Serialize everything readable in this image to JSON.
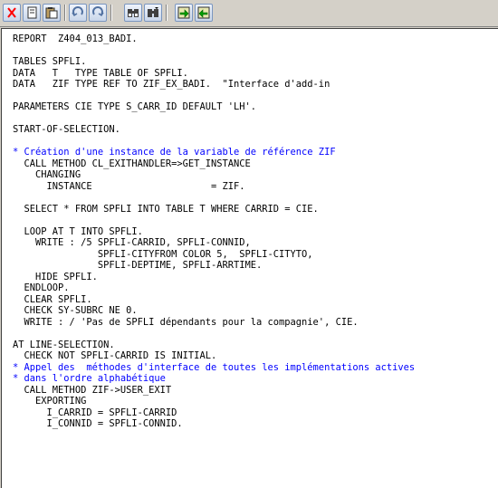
{
  "toolbar": {
    "buttons": [
      {
        "name": "cut-icon",
        "color": "#ff0000"
      },
      {
        "name": "copy-icon",
        "color": "#ffffff"
      },
      {
        "name": "paste-icon",
        "color": "#c0a060"
      },
      {
        "name": "undo-icon",
        "color": "#5070a0"
      },
      {
        "name": "redo-icon",
        "color": "#5070a0"
      },
      {
        "name": "find-icon",
        "color": "#000000"
      },
      {
        "name": "find-next-icon",
        "color": "#000000"
      },
      {
        "name": "download-icon",
        "color": "#00a000"
      },
      {
        "name": "upload-icon",
        "color": "#00a000"
      }
    ]
  },
  "code_lines": [
    {
      "text": "REPORT  Z404_013_BADI.",
      "comment": false
    },
    {
      "text": "",
      "comment": false
    },
    {
      "text": "TABLES SPFLI.",
      "comment": false
    },
    {
      "text": "DATA   T   TYPE TABLE OF SPFLI.",
      "comment": false
    },
    {
      "text": "DATA   ZIF TYPE REF TO ZIF_EX_BADI.  \"Interface d'add-in",
      "comment": false
    },
    {
      "text": "",
      "comment": false
    },
    {
      "text": "PARAMETERS CIE TYPE S_CARR_ID DEFAULT 'LH'.",
      "comment": false
    },
    {
      "text": "",
      "comment": false
    },
    {
      "text": "START-OF-SELECTION.",
      "comment": false
    },
    {
      "text": "",
      "comment": false
    },
    {
      "text": "* Création d'une instance de la variable de référence ZIF",
      "comment": true
    },
    {
      "text": "  CALL METHOD CL_EXITHANDLER=>GET_INSTANCE",
      "comment": false
    },
    {
      "text": "    CHANGING",
      "comment": false
    },
    {
      "text": "      INSTANCE                     = ZIF.",
      "comment": false
    },
    {
      "text": "",
      "comment": false
    },
    {
      "text": "  SELECT * FROM SPFLI INTO TABLE T WHERE CARRID = CIE.",
      "comment": false
    },
    {
      "text": "",
      "comment": false
    },
    {
      "text": "  LOOP AT T INTO SPFLI.",
      "comment": false
    },
    {
      "text": "    WRITE : /5 SPFLI-CARRID, SPFLI-CONNID,",
      "comment": false
    },
    {
      "text": "               SPFLI-CITYFROM COLOR 5,  SPFLI-CITYTO,",
      "comment": false
    },
    {
      "text": "               SPFLI-DEPTIME, SPFLI-ARRTIME.",
      "comment": false
    },
    {
      "text": "    HIDE SPFLI.",
      "comment": false
    },
    {
      "text": "  ENDLOOP.",
      "comment": false
    },
    {
      "text": "  CLEAR SPFLI.",
      "comment": false
    },
    {
      "text": "  CHECK SY-SUBRC NE 0.",
      "comment": false
    },
    {
      "text": "  WRITE : / 'Pas de SPFLI dépendants pour la compagnie', CIE.",
      "comment": false
    },
    {
      "text": "",
      "comment": false
    },
    {
      "text": "AT LINE-SELECTION.",
      "comment": false
    },
    {
      "text": "  CHECK NOT SPFLI-CARRID IS INITIAL.",
      "comment": false
    },
    {
      "text": "* Appel des  méthodes d'interface de toutes les implémentations actives",
      "comment": true
    },
    {
      "text": "* dans l'ordre alphabétique",
      "comment": true
    },
    {
      "text": "  CALL METHOD ZIF->USER_EXIT",
      "comment": false
    },
    {
      "text": "    EXPORTING",
      "comment": false
    },
    {
      "text": "      I_CARRID = SPFLI-CARRID",
      "comment": false
    },
    {
      "text": "      I_CONNID = SPFLI-CONNID.",
      "comment": false
    }
  ]
}
